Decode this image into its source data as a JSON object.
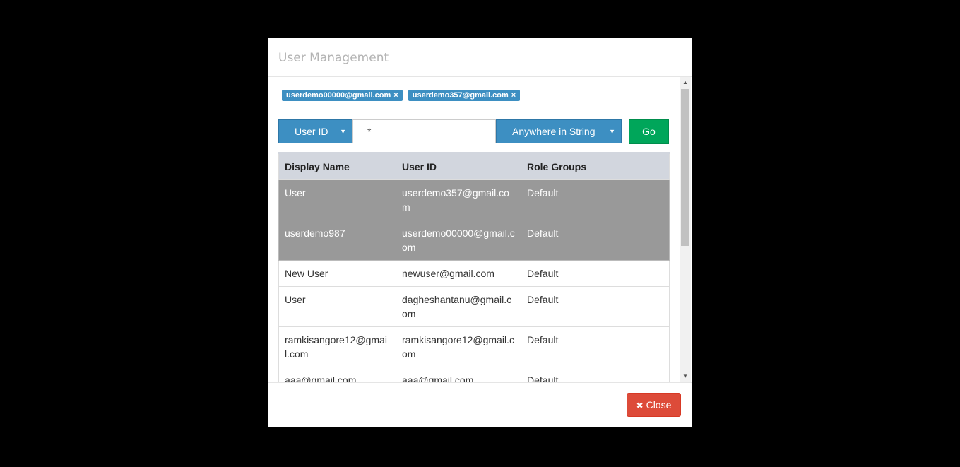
{
  "modal": {
    "title": "User Management"
  },
  "selected_tags": [
    {
      "label": "userdemo00000@gmail.com",
      "remove": "×"
    },
    {
      "label": "userdemo357@gmail.com",
      "remove": "×"
    }
  ],
  "search": {
    "field_label": "User ID",
    "value": "*",
    "match_label": "Anywhere in String",
    "caret": "▼",
    "go_label": "Go"
  },
  "table": {
    "headers": [
      "Display Name",
      "User ID",
      "Role Groups"
    ],
    "rows": [
      {
        "display_name": "User",
        "user_id": "userdemo357@gmail.com",
        "role_groups": "Default",
        "selected": true
      },
      {
        "display_name": "userdemo987",
        "user_id": "userdemo00000@gmail.com",
        "role_groups": "Default",
        "selected": true
      },
      {
        "display_name": "New User",
        "user_id": "newuser@gmail.com",
        "role_groups": "Default",
        "selected": false
      },
      {
        "display_name": "User",
        "user_id": "dagheshantanu@gmail.com",
        "role_groups": "Default",
        "selected": false
      },
      {
        "display_name": "ramkisangore12@gmail.com",
        "user_id": "ramkisangore12@gmail.com",
        "role_groups": "Default",
        "selected": false
      },
      {
        "display_name": "aaa@gmail.com",
        "user_id": "aaa@gmail.com",
        "role_groups": "Default",
        "selected": false
      }
    ]
  },
  "footer": {
    "close_icon": "✖",
    "close_label": "Close"
  },
  "colors": {
    "primary": "#3d8fc2",
    "success": "#00a65a",
    "danger": "#dd4b39",
    "selected_row": "#999999",
    "header_bg": "#d2d6de"
  }
}
